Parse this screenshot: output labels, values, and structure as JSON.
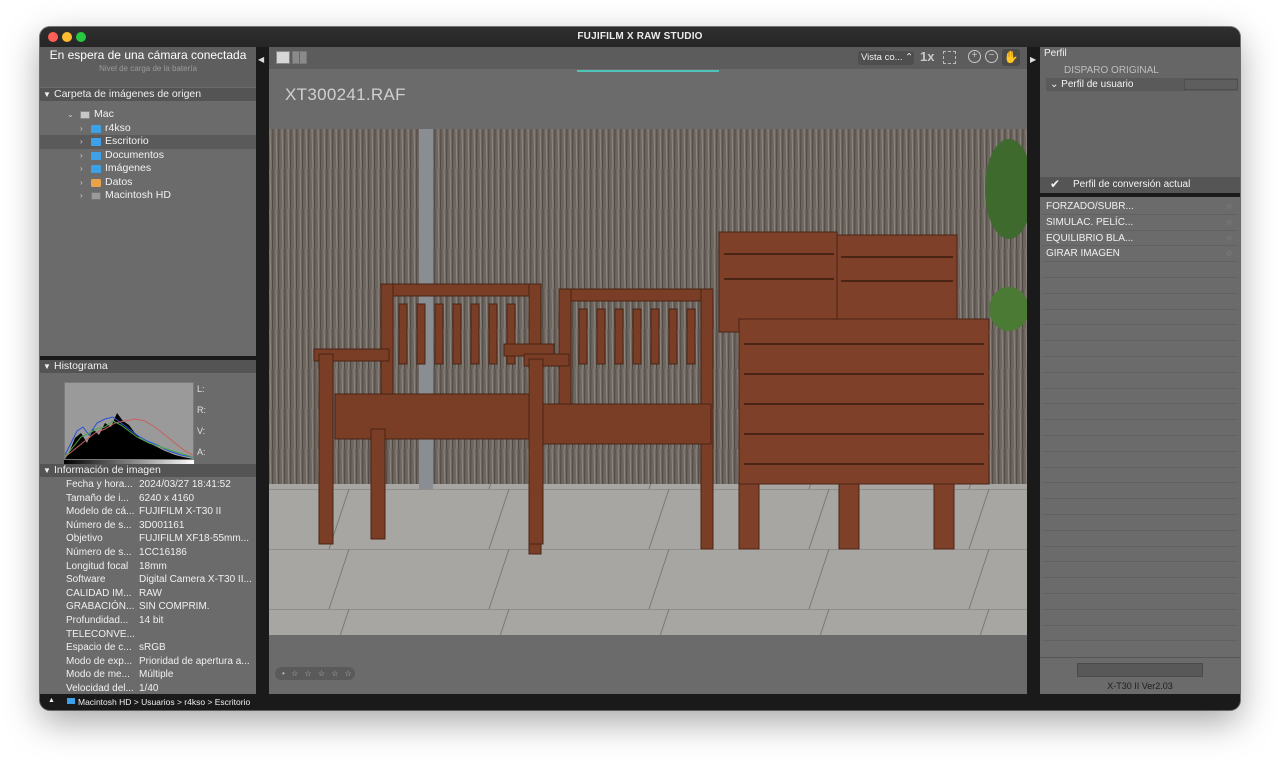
{
  "window": {
    "title": "FUJIFILM X RAW STUDIO"
  },
  "camera": {
    "status": "En espera de una cámara conectada",
    "battery_label": "Nivel de carga de la batería"
  },
  "source_folder": {
    "title": "Carpeta de imágenes de origen",
    "root": "Mac",
    "items": [
      {
        "label": "r4kso",
        "icon": "folder-icon"
      },
      {
        "label": "Escritorio",
        "icon": "folder-icon",
        "selected": true
      },
      {
        "label": "Documentos",
        "icon": "folder-icon"
      },
      {
        "label": "Imágenes",
        "icon": "folder-icon"
      },
      {
        "label": "Datos",
        "icon": "external-drive-icon"
      },
      {
        "label": "Macintosh HD",
        "icon": "hard-drive-icon"
      }
    ]
  },
  "histogram": {
    "title": "Histograma",
    "labels": [
      "L:",
      "R:",
      "V:",
      "A:"
    ]
  },
  "image_info": {
    "title": "Información de imagen",
    "rows": [
      {
        "k": "Fecha y hora...",
        "v": "2024/03/27 18:41:52"
      },
      {
        "k": "Tamaño de i...",
        "v": "6240 x 4160"
      },
      {
        "k": "Modelo de cá...",
        "v": "FUJIFILM X-T30 II"
      },
      {
        "k": "Número de s...",
        "v": "3D001161"
      },
      {
        "k": "Objetivo",
        "v": "FUJIFILM XF18-55mm..."
      },
      {
        "k": "Número de s...",
        "v": "1CC16186"
      },
      {
        "k": "Longitud focal",
        "v": "18mm"
      },
      {
        "k": "Software",
        "v": "Digital Camera X-T30 II..."
      },
      {
        "k": "CALIDAD IM...",
        "v": "RAW"
      },
      {
        "k": "GRABACIÓN...",
        "v": "SIN COMPRIM."
      },
      {
        "k": "Profundidad...",
        "v": "14 bit"
      },
      {
        "k": "TELECONVE...",
        "v": ""
      },
      {
        "k": "Espacio de c...",
        "v": "sRGB"
      },
      {
        "k": "Modo de exp...",
        "v": "Prioridad de apertura a..."
      },
      {
        "k": "Modo de me...",
        "v": "Múltiple"
      },
      {
        "k": "Velocidad del...",
        "v": "1/40"
      }
    ]
  },
  "statusbar": {
    "path": "Macintosh HD > Usuarios > r4kso > Escritorio"
  },
  "viewer": {
    "view_select": "Vista co...",
    "zoom_1x": "1x",
    "filename": "XT300241.RAF",
    "rating_stars": "• ☆ ☆ ☆ ☆ ☆"
  },
  "profile": {
    "title": "Perfil",
    "original": "DISPARO ORIGINAL",
    "user_profile": "Perfil de usuario",
    "current_conversion": "Perfil de conversión actual"
  },
  "settings": [
    {
      "label": "FORZADO/SUBR..."
    },
    {
      "label": "SIMULAC. PELÍC..."
    },
    {
      "label": "EQUILIBRIO BLA..."
    },
    {
      "label": "GIRAR IMAGEN"
    }
  ],
  "version": "X-T30 II Ver2.03",
  "colors": {
    "accent_progress": "#4fc3b8",
    "folder_blue": "#3da0e8",
    "panel_gray": "#6b6b6b"
  }
}
